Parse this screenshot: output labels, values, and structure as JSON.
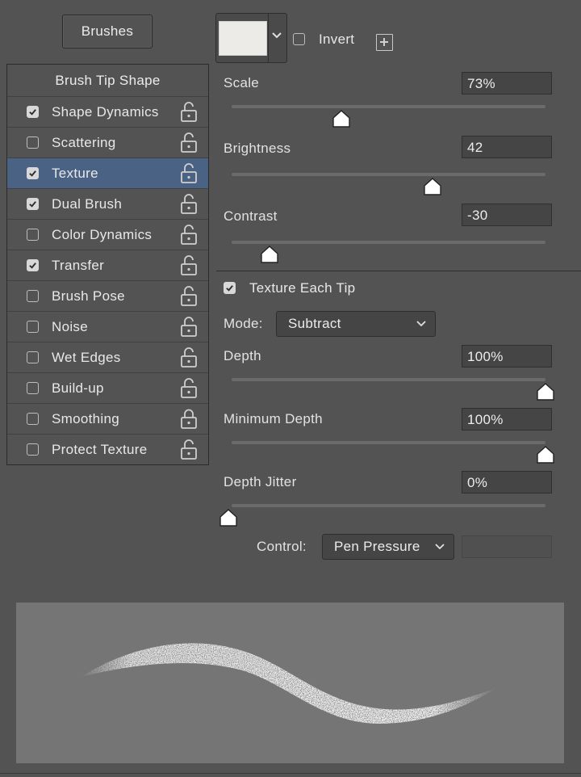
{
  "header": {
    "brushes_label": "Brushes",
    "invert_label": "Invert",
    "invert_checked": false
  },
  "options": {
    "title": "Brush Tip Shape",
    "items": [
      {
        "label": "Shape Dynamics",
        "checked": true,
        "selected": false,
        "locked": false
      },
      {
        "label": "Scattering",
        "checked": false,
        "selected": false,
        "locked": false
      },
      {
        "label": "Texture",
        "checked": true,
        "selected": true,
        "locked": false
      },
      {
        "label": "Dual Brush",
        "checked": true,
        "selected": false,
        "locked": false
      },
      {
        "label": "Color Dynamics",
        "checked": false,
        "selected": false,
        "locked": false
      },
      {
        "label": "Transfer",
        "checked": true,
        "selected": false,
        "locked": false
      },
      {
        "label": "Brush Pose",
        "checked": false,
        "selected": false,
        "locked": false
      },
      {
        "label": "Noise",
        "checked": false,
        "selected": false,
        "locked": false
      },
      {
        "label": "Wet Edges",
        "checked": false,
        "selected": false,
        "locked": false
      },
      {
        "label": "Build-up",
        "checked": false,
        "selected": false,
        "locked": false
      },
      {
        "label": "Smoothing",
        "checked": false,
        "selected": false,
        "locked": true
      },
      {
        "label": "Protect Texture",
        "checked": false,
        "selected": false,
        "locked": false
      }
    ]
  },
  "texture": {
    "scale": {
      "label": "Scale",
      "value": "73%",
      "fraction": 0.35
    },
    "brightness": {
      "label": "Brightness",
      "value": "42",
      "fraction": 0.64
    },
    "contrast": {
      "label": "Contrast",
      "value": "-30",
      "fraction": 0.12
    },
    "texture_each_tip": {
      "label": "Texture Each Tip",
      "checked": true
    },
    "mode": {
      "label": "Mode:",
      "value": "Subtract"
    },
    "depth": {
      "label": "Depth",
      "value": "100%",
      "fraction": 1.0
    },
    "minimum_depth": {
      "label": "Minimum Depth",
      "value": "100%",
      "fraction": 1.0
    },
    "depth_jitter": {
      "label": "Depth Jitter",
      "value": "0%",
      "fraction": 0.0
    },
    "control": {
      "label": "Control:",
      "value": "Pen Pressure",
      "extra_value": ""
    }
  }
}
